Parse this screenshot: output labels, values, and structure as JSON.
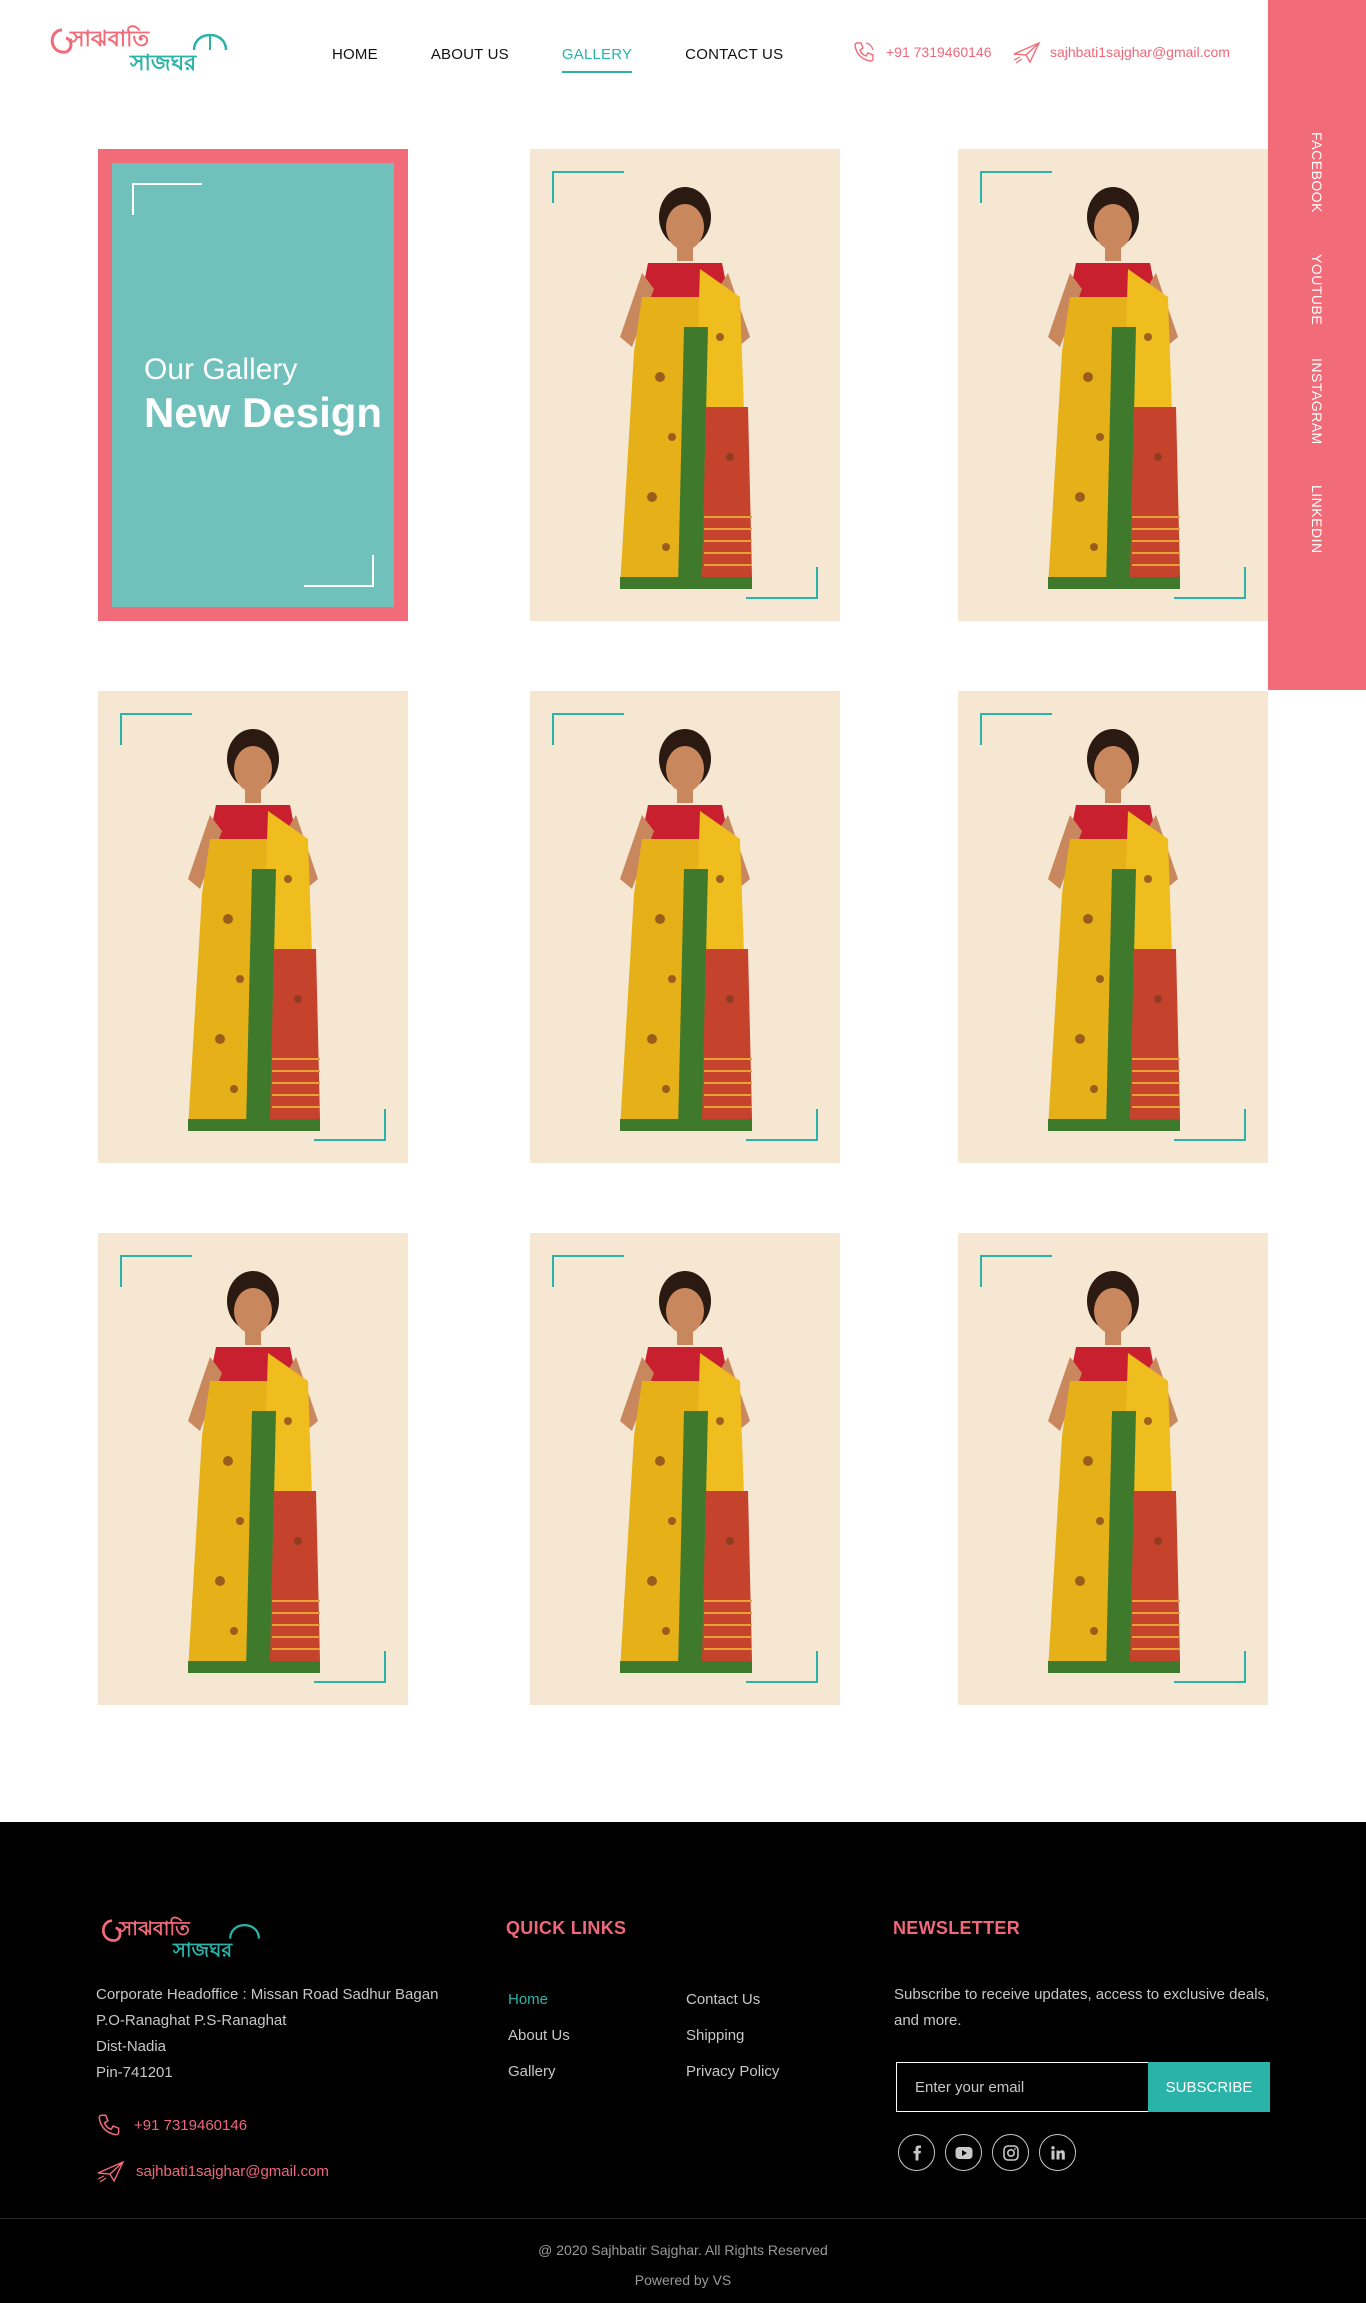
{
  "brand": {
    "logo_line1": "সাঝবাতি",
    "logo_line2": "সাজঘর",
    "primary_color": "#f26b78",
    "accent_color": "#2ab3a8"
  },
  "nav": {
    "items": [
      {
        "label": "HOME"
      },
      {
        "label": "ABOUT US"
      },
      {
        "label": "GALLERY"
      },
      {
        "label": "CONTACT US"
      }
    ],
    "active": "GALLERY"
  },
  "header_contact": {
    "phone": "+91 7319460146",
    "email": "sajhbati1sajghar@gmail.com"
  },
  "social": [
    "FACEBOOK",
    "YOUTUBE",
    "INSTAGRAM",
    "LINKEDIN"
  ],
  "gallery": {
    "intro_sub": "Our Gallery",
    "intro_title": "New Design",
    "tile_count": 8
  },
  "footer": {
    "address": [
      "Corporate Headoffice : Missan Road Sadhur Bagan",
      "P.O-Ranaghat P.S-Ranaghat",
      "Dist-Nadia",
      "Pin-741201"
    ],
    "phone": "+91 7319460146",
    "email": "sajhbati1sajghar@gmail.com",
    "quick_links_heading": "QUICK LINKS",
    "quick_links_col1": [
      "Home",
      "About Us",
      "Gallery"
    ],
    "quick_links_col2": [
      "Contact Us",
      "Shipping",
      "Privacy Policy"
    ],
    "newsletter_heading": "NEWSLETTER",
    "newsletter_text": "Subscribe to receive updates, access to exclusive deals, and more.",
    "newsletter_placeholder": "Enter your email",
    "subscribe_label": "SUBSCRIBE",
    "social_icons": [
      "facebook-icon",
      "youtube-icon",
      "instagram-icon",
      "linkedin-icon"
    ],
    "copyright": "@ 2020 Sajhbatir Sajghar. All Rights Reserved",
    "powered": "Powered by VS"
  }
}
